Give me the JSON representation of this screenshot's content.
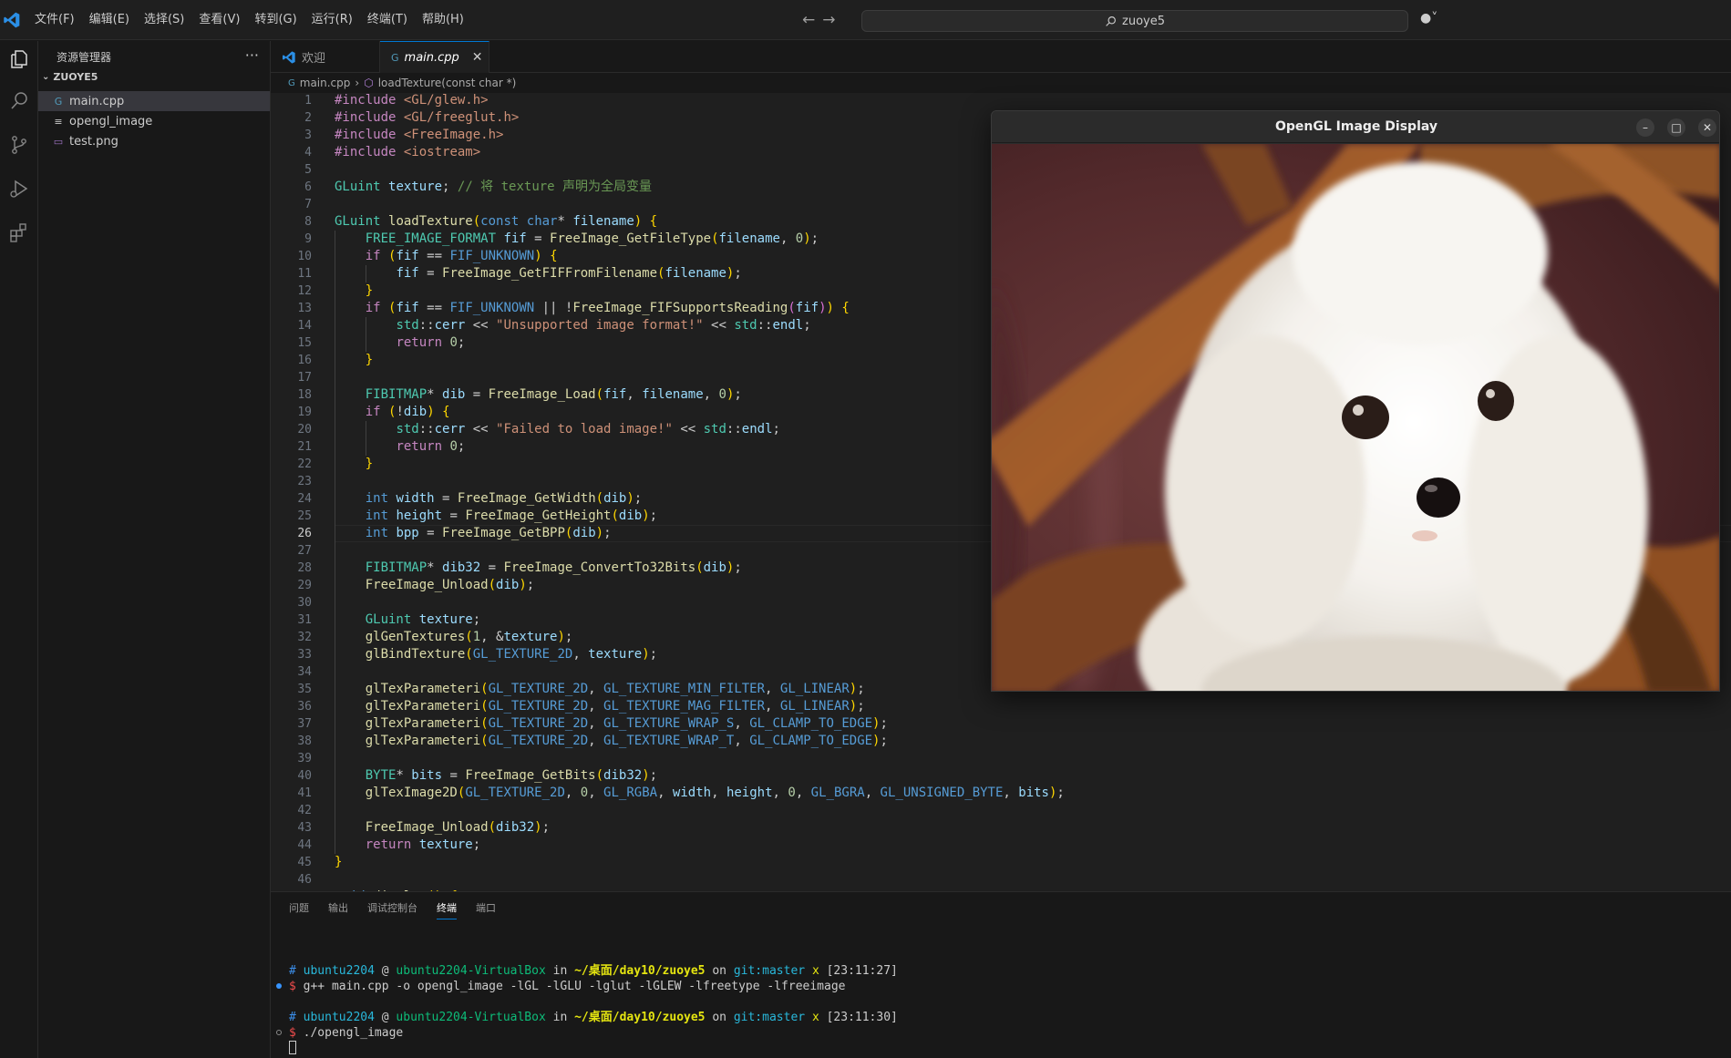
{
  "menus": [
    "文件(F)",
    "编辑(E)",
    "选择(S)",
    "查看(V)",
    "转到(G)",
    "运行(R)",
    "终端(T)",
    "帮助(H)"
  ],
  "search": {
    "text": "zuoye5"
  },
  "sidebar": {
    "title": "资源管理器",
    "folder": "ZUOYE5",
    "files": [
      {
        "name": "main.cpp",
        "icon": "cpp-file-icon",
        "active": true
      },
      {
        "name": "opengl_image",
        "icon": "text-file-icon",
        "active": false
      },
      {
        "name": "test.png",
        "icon": "image-file-icon",
        "active": false
      }
    ]
  },
  "tabs": [
    {
      "label": "欢迎",
      "icon": "vscode-icon"
    },
    {
      "label": "main.cpp",
      "icon": "cpp-file-icon",
      "active": true
    }
  ],
  "breadcrumb": {
    "file": "main.cpp",
    "symbol": "loadTexture(const char *)"
  },
  "editor": {
    "current_line": 26,
    "lines": [
      "#include <GL/glew.h>",
      "#include <GL/freeglut.h>",
      "#include <FreeImage.h>",
      "#include <iostream>",
      "",
      "GLuint texture; // 将 texture 声明为全局变量",
      "",
      "GLuint loadTexture(const char* filename) {",
      "    FREE_IMAGE_FORMAT fif = FreeImage_GetFileType(filename, 0);",
      "    if (fif == FIF_UNKNOWN) {",
      "        fif = FreeImage_GetFIFFromFilename(filename);",
      "    }",
      "    if (fif == FIF_UNKNOWN || !FreeImage_FIFSupportsReading(fif)) {",
      "        std::cerr << \"Unsupported image format!\" << std::endl;",
      "        return 0;",
      "    }",
      "",
      "    FIBITMAP* dib = FreeImage_Load(fif, filename, 0);",
      "    if (!dib) {",
      "        std::cerr << \"Failed to load image!\" << std::endl;",
      "        return 0;",
      "    }",
      "",
      "    int width = FreeImage_GetWidth(dib);",
      "    int height = FreeImage_GetHeight(dib);",
      "    int bpp = FreeImage_GetBPP(dib);",
      "",
      "    FIBITMAP* dib32 = FreeImage_ConvertTo32Bits(dib);",
      "    FreeImage_Unload(dib);",
      "",
      "    GLuint texture;",
      "    glGenTextures(1, &texture);",
      "    glBindTexture(GL_TEXTURE_2D, texture);",
      "",
      "    glTexParameteri(GL_TEXTURE_2D, GL_TEXTURE_MIN_FILTER, GL_LINEAR);",
      "    glTexParameteri(GL_TEXTURE_2D, GL_TEXTURE_MAG_FILTER, GL_LINEAR);",
      "    glTexParameteri(GL_TEXTURE_2D, GL_TEXTURE_WRAP_S, GL_CLAMP_TO_EDGE);",
      "    glTexParameteri(GL_TEXTURE_2D, GL_TEXTURE_WRAP_T, GL_CLAMP_TO_EDGE);",
      "",
      "    BYTE* bits = FreeImage_GetBits(dib32);",
      "    glTexImage2D(GL_TEXTURE_2D, 0, GL_RGBA, width, height, 0, GL_BGRA, GL_UNSIGNED_BYTE, bits);",
      "",
      "    FreeImage_Unload(dib32);",
      "    return texture;",
      "}",
      "",
      "void display() {"
    ]
  },
  "panel": {
    "tabs": [
      "问题",
      "输出",
      "调试控制台",
      "终端",
      "端口"
    ],
    "active_tab": "终端",
    "terminal": [
      {
        "user": "ubuntu2204",
        "host": "ubuntu2204-VirtualBox",
        "path": "~/桌面/day10/zuoye5",
        "branch": "git:master",
        "dirty": "x",
        "time": "[23:11:27]",
        "command": "g++ main.cpp -o opengl_image -lGL -lGLU -lglut -lGLEW -lfreetype -lfreeimage",
        "status": "done"
      },
      {
        "user": "ubuntu2204",
        "host": "ubuntu2204-VirtualBox",
        "path": "~/桌面/day10/zuoye5",
        "branch": "git:master",
        "dirty": "x",
        "time": "[23:11:30]",
        "command": "./opengl_image",
        "status": "running"
      }
    ]
  },
  "gl_window": {
    "title": "OpenGL Image Display",
    "image": "maltese-puppy-photo"
  },
  "colors": {
    "accent": "#0078d4",
    "editor_bg": "#1f1f1f",
    "sidebar_bg": "#181818"
  }
}
